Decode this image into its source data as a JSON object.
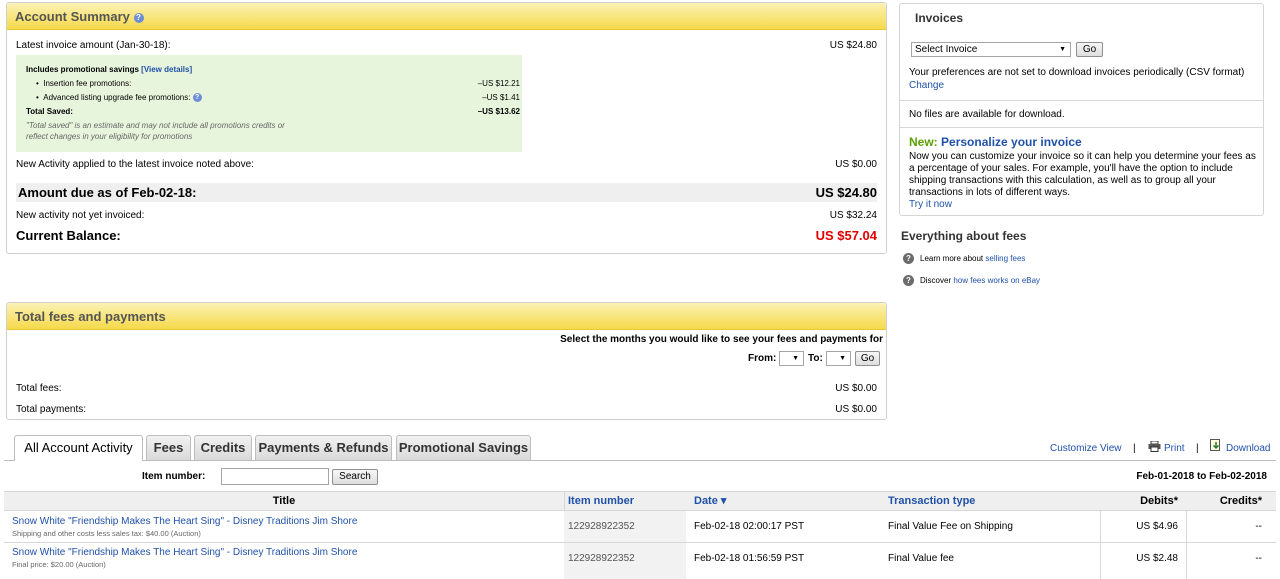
{
  "account_summary": {
    "title": "Account Summary",
    "latest_invoice_label": "Latest invoice amount (Jan-30-18):",
    "latest_invoice_value": "US $24.80",
    "promo": {
      "heading": "Includes promotional savings",
      "view_details": "[View details]",
      "items": [
        {
          "label": "Insertion fee promotions:",
          "value": "–US $12.21"
        },
        {
          "label": "Advanced listing upgrade fee promotions:",
          "value": "–US $1.41"
        }
      ],
      "total_label": "Total Saved:",
      "total_value": "–US $13.62",
      "note_line1": "\"Total saved\" is an estimate and may not include all promotions credits or",
      "note_line2": "reflect changes in your eligibility for promotions"
    },
    "new_activity_label": "New Activity applied to the latest invoice noted above:",
    "new_activity_value": "US $0.00",
    "amount_due_label": "Amount due as of Feb-02-18:",
    "amount_due_value": "US $24.80",
    "not_invoiced_label": "New activity not yet invoiced:",
    "not_invoiced_value": "US $32.24",
    "current_balance_label": "Current Balance:",
    "current_balance_value": "US $57.04"
  },
  "invoices": {
    "title": "Invoices",
    "select_value": "Select Invoice",
    "go": "Go",
    "pref_text": "Your preferences are not set to download invoices periodically (CSV format)",
    "change": "Change",
    "no_files": "No files are available for download.",
    "new_label": "New:",
    "personalize_title": "Personalize your invoice",
    "personalize_lines": [
      "Now you can customize your invoice so it can help you determine your fees as",
      "a percentage of your sales. For example, you'll have the option to include",
      "shipping transactions with this calculation, as well as to group all your",
      "transactions in lots of different ways."
    ],
    "try_it": "Try it now"
  },
  "fees_info": {
    "title": "Everything about fees",
    "line1_prefix": "Learn more about ",
    "line1_link": "selling fees",
    "line2_prefix": "Discover ",
    "line2_link": "how fees works on eBay"
  },
  "total_fees": {
    "title": "Total fees and payments",
    "select_months": "Select the months you would like to see your fees and payments for",
    "from": "From:",
    "to": "To:",
    "go": "Go",
    "fees_label": "Total fees:",
    "fees_value": "US $0.00",
    "payments_label": "Total payments:",
    "payments_value": "US $0.00"
  },
  "tabs": [
    {
      "label": "All Account Activity",
      "active": true
    },
    {
      "label": "Fees"
    },
    {
      "label": "Credits"
    },
    {
      "label": "Payments & Refunds"
    },
    {
      "label": "Promotional Savings"
    }
  ],
  "toolbar": {
    "customize": "Customize View",
    "sep": "|",
    "print": "Print",
    "download": "Download"
  },
  "search": {
    "label": "Item number:",
    "value": "",
    "button": "Search",
    "date_range": "Feb-01-2018 to Feb-02-2018"
  },
  "table": {
    "columns": [
      "Title",
      "Item number",
      "Date ▾",
      "Transaction type",
      "Debits*",
      "Credits*"
    ],
    "rows": [
      {
        "title": "Snow White \"Friendship Makes The Heart Sing\" - Disney Traditions Jim Shore",
        "sub": "Shipping and other costs less sales tax: $40.00 (Auction)",
        "item": "122928922352",
        "date": "Feb-02-18 02:00:17 PST",
        "type": "Final Value Fee on Shipping",
        "debit": "US $4.96",
        "credit": "--"
      },
      {
        "title": "Snow White \"Friendship Makes The Heart Sing\" - Disney Traditions Jim Shore",
        "sub": "Final price: $20.00 (Auction)",
        "item": "122928922352",
        "date": "Feb-02-18 01:56:59 PST",
        "type": "Final Value fee",
        "debit": "US $2.48",
        "credit": "--"
      }
    ]
  },
  "colors": {
    "header_yellow": "#f6d94a",
    "promo_green": "#e8f5dd",
    "link_blue": "#2051a8",
    "balance_red": "#e30000",
    "new_green": "#5ba000"
  }
}
